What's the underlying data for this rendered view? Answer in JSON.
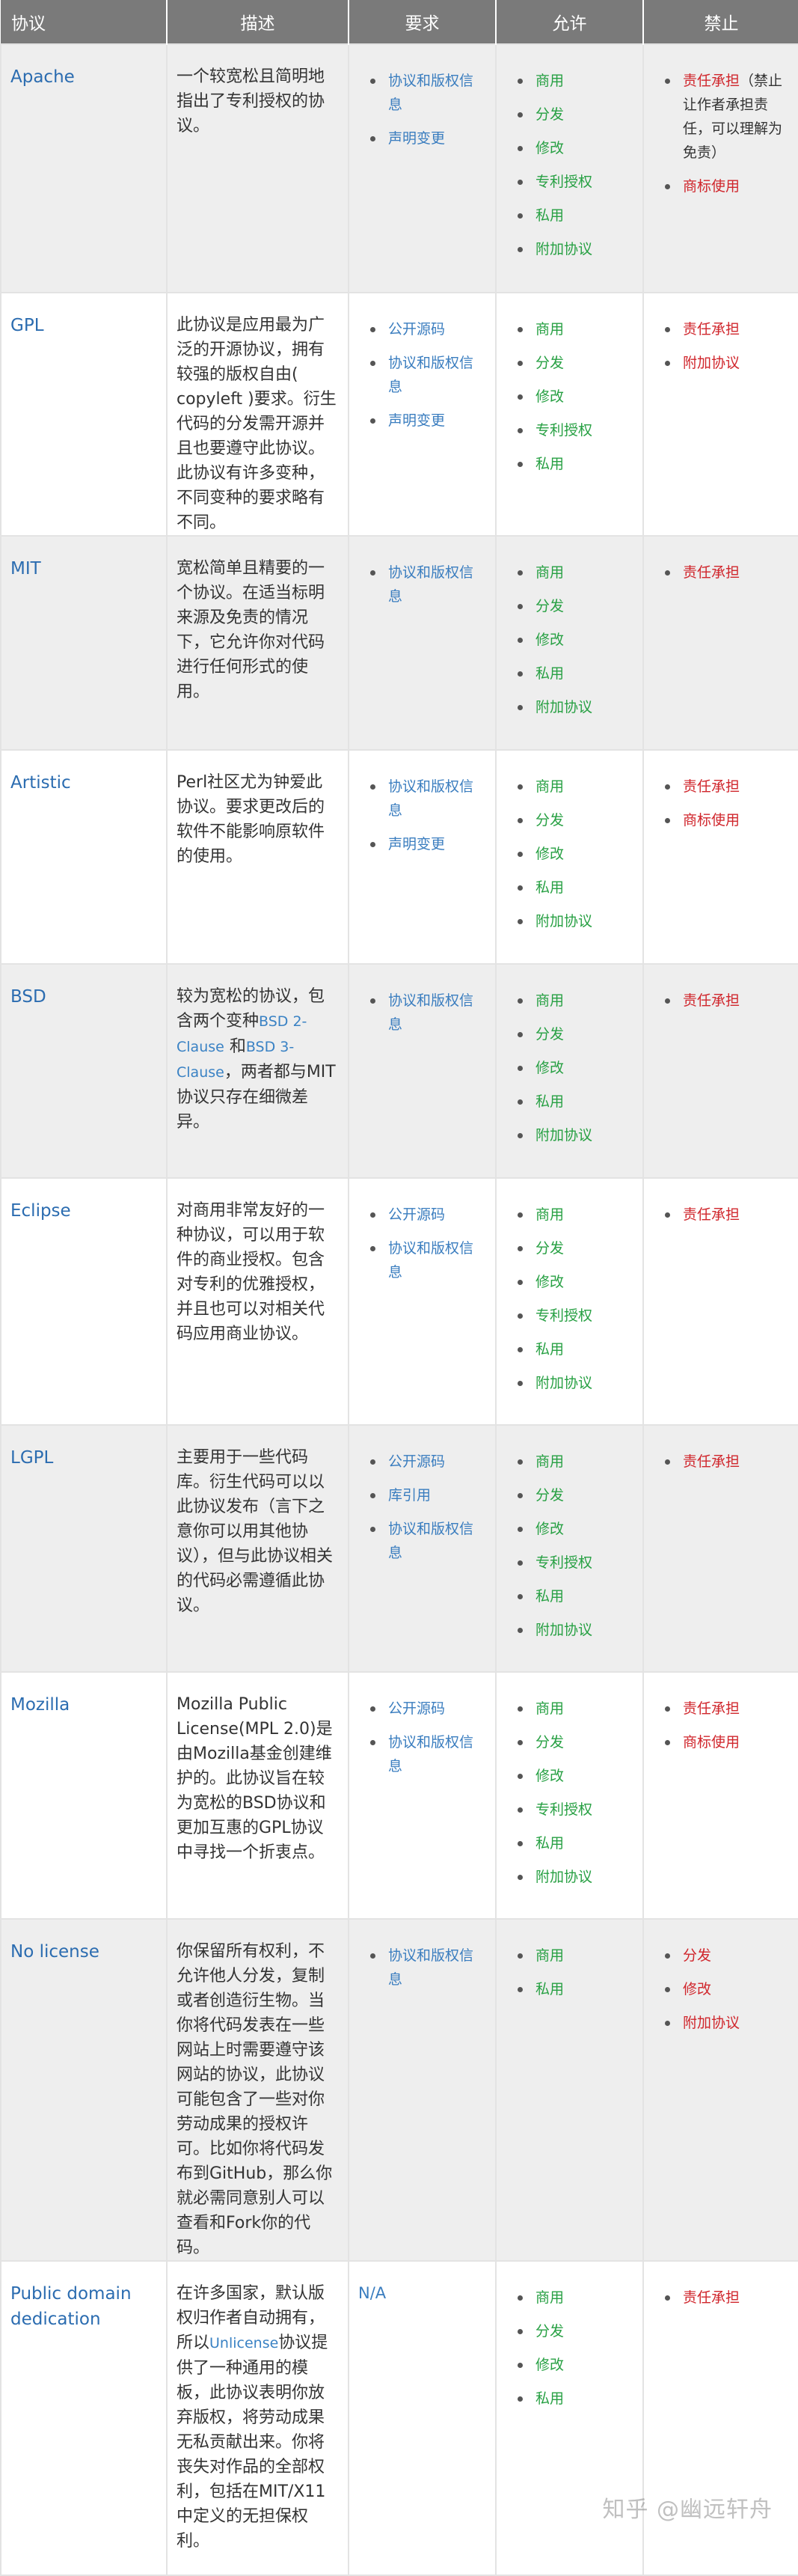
{
  "headers": {
    "protocol": "协议",
    "description": "描述",
    "requirements": "要求",
    "permissions": "允许",
    "forbidden": "禁止"
  },
  "rows": [
    {
      "name": "Apache",
      "desc": "一个较宽松且简明地指出了专利授权的协议。",
      "requirements": [
        "协议和版权信息",
        "声明变更"
      ],
      "permissions": [
        "商用",
        "分发",
        "修改",
        "专利授权",
        "私用",
        "附加协议"
      ],
      "forbidden": [
        "责任承担",
        "商标使用"
      ],
      "forbidden_note": "（禁止让作者承担责任，可以理解为免责）"
    },
    {
      "name": "GPL",
      "desc": "此协议是应用最为广泛的开源协议，拥有较强的版权自由( copyleft )要求。衍生代码的分发需开源并且也要遵守此协议。此协议有许多变种，不同变种的要求略有不同。",
      "requirements": [
        "公开源码",
        "协议和版权信息",
        "声明变更"
      ],
      "permissions": [
        "商用",
        "分发",
        "修改",
        "专利授权",
        "私用"
      ],
      "forbidden": [
        "责任承担",
        "附加协议"
      ]
    },
    {
      "name": "MIT",
      "desc": "宽松简单且精要的一个协议。在适当标明来源及免责的情况下，它允许你对代码进行任何形式的使用。",
      "requirements": [
        "协议和版权信息"
      ],
      "permissions": [
        "商用",
        "分发",
        "修改",
        "私用",
        "附加协议"
      ],
      "forbidden": [
        "责任承担"
      ]
    },
    {
      "name": "Artistic",
      "desc": "Perl社区尤为钟爱此协议。要求更改后的软件不能影响原软件的使用。",
      "requirements": [
        "协议和版权信息",
        "声明变更"
      ],
      "permissions": [
        "商用",
        "分发",
        "修改",
        "私用",
        "附加协议"
      ],
      "forbidden": [
        "责任承担",
        "商标使用"
      ]
    },
    {
      "name": "BSD",
      "desc_parts": [
        "较为宽松的协议，包含两个变种",
        "BSD 2-Clause",
        " 和",
        "BSD 3-Clause",
        "，两者都与MIT协议只存在细微差异。"
      ],
      "requirements": [
        "协议和版权信息"
      ],
      "permissions": [
        "商用",
        "分发",
        "修改",
        "私用",
        "附加协议"
      ],
      "forbidden": [
        "责任承担"
      ]
    },
    {
      "name": "Eclipse",
      "desc": "对商用非常友好的一种协议，可以用于软件的商业授权。包含对专利的优雅授权，并且也可以对相关代码应用商业协议。",
      "requirements": [
        "公开源码",
        "协议和版权信息"
      ],
      "permissions": [
        "商用",
        "分发",
        "修改",
        "专利授权",
        "私用",
        "附加协议"
      ],
      "forbidden": [
        "责任承担"
      ]
    },
    {
      "name": "LGPL",
      "desc": "主要用于一些代码库。衍生代码可以以此协议发布（言下之意你可以用其他协议），但与此协议相关的代码必需遵循此协议。",
      "requirements": [
        "公开源码",
        "库引用",
        "协议和版权信息"
      ],
      "permissions": [
        "商用",
        "分发",
        "修改",
        "专利授权",
        "私用",
        "附加协议"
      ],
      "forbidden": [
        "责任承担"
      ]
    },
    {
      "name": "Mozilla",
      "desc": "Mozilla Public License(MPL 2.0)是由Mozilla基金创建维护的。此协议旨在较为宽松的BSD协议和更加互惠的GPL协议中寻找一个折衷点。",
      "requirements": [
        "公开源码",
        "协议和版权信息"
      ],
      "permissions": [
        "商用",
        "分发",
        "修改",
        "专利授权",
        "私用",
        "附加协议"
      ],
      "forbidden": [
        "责任承担",
        "商标使用"
      ]
    },
    {
      "name": "No license",
      "desc": "你保留所有权利，不允许他人分发，复制或者创造衍生物。当你将代码发表在一些网站上时需要遵守该网站的协议，此协议可能包含了一些对你劳动成果的授权许可。比如你将代码发布到GitHub，那么你就必需同意别人可以查看和Fork你的代码。",
      "requirements": [
        "协议和版权信息"
      ],
      "permissions": [
        "商用",
        "私用"
      ],
      "forbidden": [
        "分发",
        "修改",
        "附加协议"
      ]
    },
    {
      "name": "Public domain dedication",
      "desc_parts": [
        "在许多国家，默认版权归作者自动拥有，所以",
        "Unlicense",
        "协议提供了一种通用的模板，此协议表明你放弃版权，将劳动成果无私贡献出来。你将丧失对作品的全部权利，包括在MIT/X11中定义的无担保权利。"
      ],
      "requirements_text": "N/A",
      "permissions": [
        "商用",
        "分发",
        "修改",
        "私用"
      ],
      "forbidden": [
        "责任承担"
      ]
    }
  ],
  "watermark": "知乎 @幽远轩舟",
  "colors": {
    "header_bg": "#7a7a7a",
    "shade_bg": "#eeeeee",
    "link": "#2b6cb0",
    "permission": "#27a043",
    "forbidden": "#d0262c"
  }
}
